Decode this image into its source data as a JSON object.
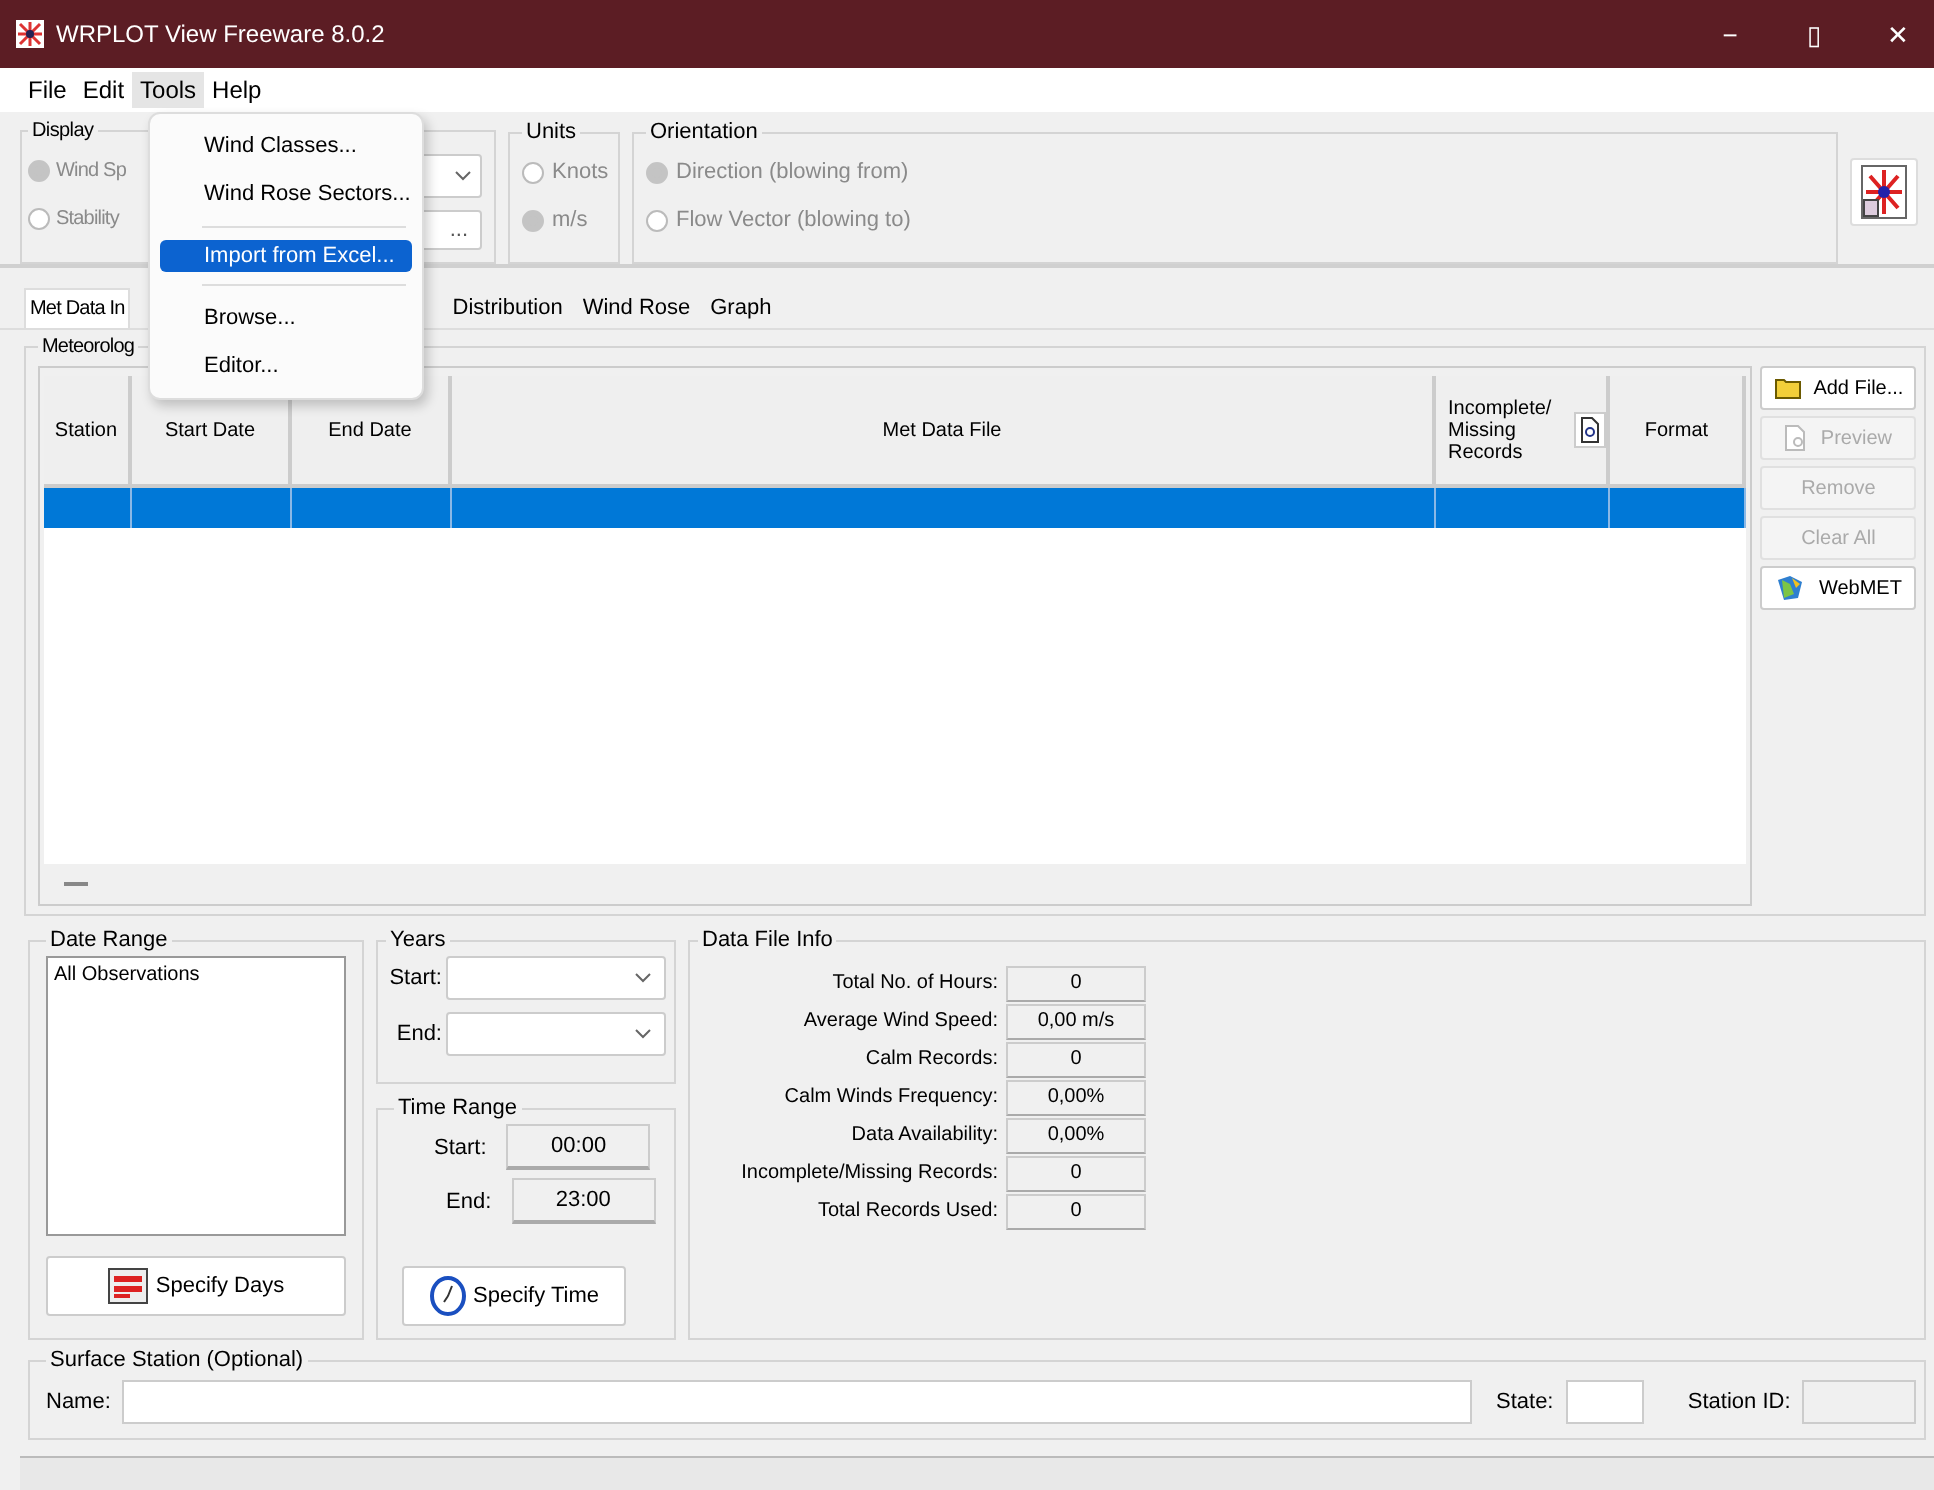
{
  "window": {
    "title": "WRPLOT View Freeware 8.0.2",
    "controls": [
      "−",
      "▯",
      "✕"
    ]
  },
  "menu_bar": [
    {
      "label": "File",
      "selected": false
    },
    {
      "label": "Edit",
      "selected": false
    },
    {
      "label": "Tools",
      "selected": true
    },
    {
      "label": "Help",
      "selected": false
    }
  ],
  "open_menu": {
    "items": [
      {
        "kind": "item",
        "label": "Wind Classes...",
        "selected": false
      },
      {
        "kind": "item",
        "label": "Wind Rose Sectors...",
        "selected": false
      },
      {
        "kind": "separator"
      },
      {
        "kind": "item",
        "label": "Import from Excel...",
        "selected": true
      },
      {
        "kind": "separator"
      },
      {
        "kind": "item",
        "label": "Browse...",
        "selected": false
      },
      {
        "kind": "item",
        "label": "Editor...",
        "selected": false
      }
    ]
  },
  "display": {
    "title": "Display",
    "options": [
      {
        "label": "Wind Sp",
        "selected": true
      },
      {
        "label": "Stability",
        "selected": false
      }
    ],
    "field_value": "..."
  },
  "units": {
    "title": "Units",
    "options": [
      {
        "label": "Knots",
        "selected": false
      },
      {
        "label": "m/s",
        "selected": true
      }
    ]
  },
  "orientation": {
    "title": "Orientation",
    "options": [
      {
        "label": "Direction (blowing from)",
        "selected": true
      },
      {
        "label": "Flow Vector (blowing to)",
        "selected": false
      }
    ]
  },
  "tabs": [
    {
      "label": "Met Data In",
      "selected": true
    },
    {
      "label": "Distribution",
      "selected": false
    },
    {
      "label": "Wind Rose",
      "selected": false
    },
    {
      "label": "Graph",
      "selected": false
    }
  ],
  "met_data": {
    "title": "Meteorolog",
    "columns": [
      "Station",
      "Start Date",
      "End Date",
      "Met Data File",
      "Incomplete/ Missing Records",
      "Format"
    ],
    "rows": [
      {
        "selected": true
      }
    ],
    "buttons": [
      {
        "label": "Add File...",
        "disabled": false
      },
      {
        "label": "Preview",
        "disabled": true
      },
      {
        "label": "Remove",
        "disabled": true
      },
      {
        "label": "Clear All",
        "disabled": true
      },
      {
        "label": "WebMET",
        "disabled": false
      }
    ]
  },
  "date_range": {
    "title": "Date Range",
    "items": [
      "All Observations"
    ],
    "button": "Specify Days"
  },
  "years": {
    "title": "Years",
    "start_label": "Start:",
    "end_label": "End:"
  },
  "time_range": {
    "title": "Time Range",
    "start_label": "Start:",
    "start": "00:00",
    "end_label": "End:",
    "end": "23:00",
    "button": "Specify Time"
  },
  "data_file_info": {
    "title": "Data File Info",
    "rows": [
      {
        "label": "Total No. of Hours:",
        "value": "0"
      },
      {
        "label": "Average Wind Speed:",
        "value": "0,00 m/s"
      },
      {
        "label": "Calm Records:",
        "value": "0"
      },
      {
        "label": "Calm Winds Frequency:",
        "value": "0,00%"
      },
      {
        "label": "Data Availability:",
        "value": "0,00%"
      },
      {
        "label": "Incomplete/Missing Records:",
        "value": "0"
      },
      {
        "label": "Total Records Used:",
        "value": "0"
      }
    ]
  },
  "surface_station": {
    "title": "Surface Station (Optional)",
    "name_label": "Name:",
    "state_label": "State:",
    "station_id_label": "Station ID:"
  }
}
